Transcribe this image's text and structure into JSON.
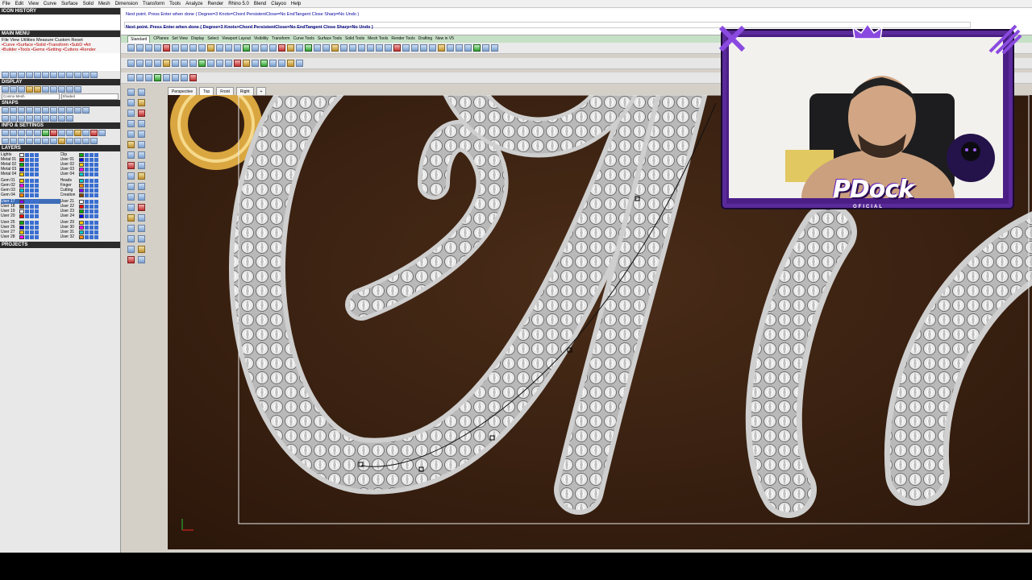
{
  "menubar": [
    "File",
    "Edit",
    "View",
    "Curve",
    "Surface",
    "Solid",
    "Mesh",
    "Dimension",
    "Transform",
    "Tools",
    "Analyze",
    "Render",
    "Rhino 5.0",
    "Blend",
    "Clayoo",
    "Help"
  ],
  "left_panel": {
    "icon_history": "ICON HISTORY",
    "main_menu": "MAIN MENU",
    "main_menu_rows": [
      "File  View  Utilities  Measure  Custom      Reset",
      "•Curve •Surface •Solid •Transform •SubD  •Art",
      "•Builder •Tools •Gems •Setting •Cutters •Render"
    ],
    "display": "DISPLAY",
    "display_select_1": "Cosmo Mesh",
    "display_select_2": "Shaded",
    "snaps": "SNAPS",
    "info_settings": "INFO & SETTINGS",
    "layers_title": "LAYERS",
    "projects": "PROJECTS",
    "layers": [
      {
        "left": [
          "Lights",
          "Metal 01",
          "Metal 02",
          "Metal 03",
          "Metal 04"
        ],
        "right": [
          "Clip",
          "User 01",
          "User 02",
          "User 03",
          "User 04"
        ]
      },
      {
        "left": [
          "Gem 01",
          "Gem 02",
          "Gem 03",
          "Gem 04"
        ],
        "right": [
          "Heads",
          "Finger",
          "Cutting",
          "Creation"
        ]
      },
      {
        "left": [
          "User 17",
          "User 18",
          "User 19",
          "User 20"
        ],
        "right": [
          "User 21",
          "User 22",
          "User 23",
          "User 24"
        ]
      },
      {
        "left": [
          "User 25",
          "User 26",
          "User 27",
          "User 28"
        ],
        "right": [
          "User 29",
          "User 30",
          "User 31",
          "User 32"
        ]
      }
    ]
  },
  "command": {
    "line1": "Next point. Press Enter when done ( Degree=3  Knots=Chord  PersistentClose=No  EndTangent  Close  Sharp=No  Undo )",
    "line2": "Next point. Press Enter when done ( Degree=3  Knots=Chord  PersistentClose=No  EndTangent  Close  Sharp=No  Undo )"
  },
  "toolbar_tabs": [
    "Standard",
    "CPlanes",
    "Set View",
    "Display",
    "Select",
    "Viewport Layout",
    "Visibility",
    "Transform",
    "Curve Tools",
    "Surface Tools",
    "Solid Tools",
    "Mesh Tools",
    "Render Tools",
    "Drafting",
    "New in V5"
  ],
  "viewport_tabs": [
    "Perspective",
    "Top",
    "Front",
    "Right",
    "+"
  ],
  "viewport_label": "Top",
  "webcam": {
    "logo": "PDock",
    "subtitle": "OFICIAL"
  },
  "colors": {
    "accent_purple": "#5a2a9a",
    "viewport_bg": "#3a2212",
    "gold": "#d9a640"
  }
}
